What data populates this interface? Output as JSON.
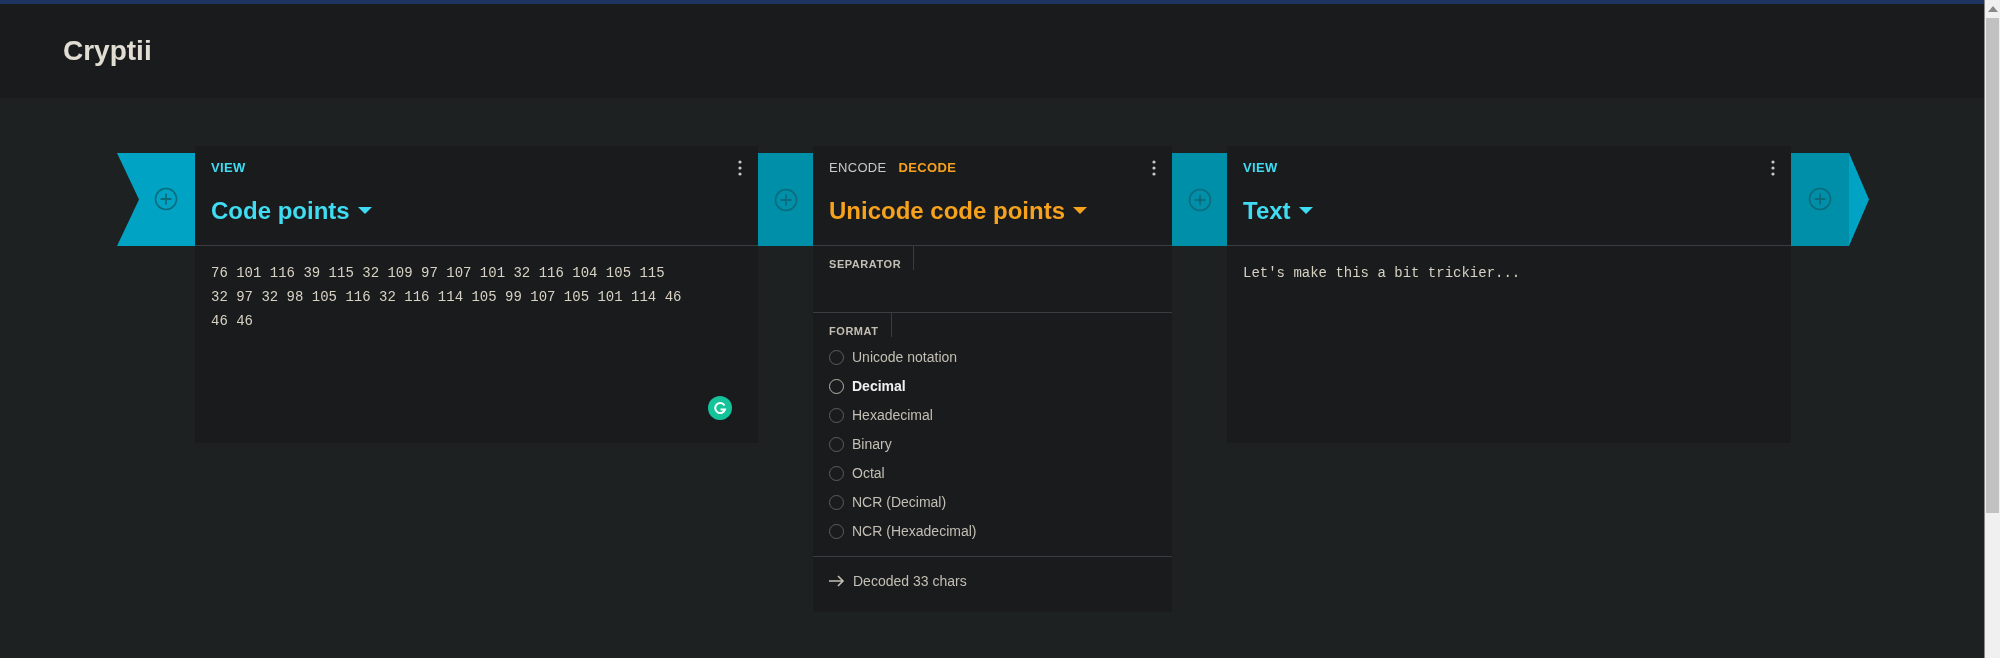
{
  "app": {
    "title": "Cryptii"
  },
  "bricks": [
    {
      "kind": "viewer",
      "label": "VIEW",
      "title": "Code points",
      "lines": [
        "76 101 116 39 115 32 109 97 107 101 32 116 104 105 115",
        "32 97 32 98 105 116 32 116 114 105 99 107 105 101 114 46",
        "46 46"
      ]
    },
    {
      "kind": "encoder",
      "tabs": [
        {
          "label": "ENCODE",
          "selected": false
        },
        {
          "label": "DECODE",
          "selected": true
        }
      ],
      "title": "Unicode code points",
      "settings": [
        {
          "kind": "text",
          "label": "SEPARATOR"
        },
        {
          "kind": "radio",
          "label": "FORMAT",
          "options": [
            {
              "label": "Unicode notation",
              "selected": false
            },
            {
              "label": "Decimal",
              "selected": true
            },
            {
              "label": "Hexadecimal",
              "selected": false
            },
            {
              "label": "Binary",
              "selected": false
            },
            {
              "label": "Octal",
              "selected": false
            },
            {
              "label": "NCR (Decimal)",
              "selected": false
            },
            {
              "label": "NCR (Hexadecimal)",
              "selected": false
            }
          ]
        }
      ],
      "status": "Decoded 33 chars"
    },
    {
      "kind": "viewer",
      "label": "VIEW",
      "title": "Text",
      "lines": [
        "Let's make this a bit trickier..."
      ]
    }
  ]
}
